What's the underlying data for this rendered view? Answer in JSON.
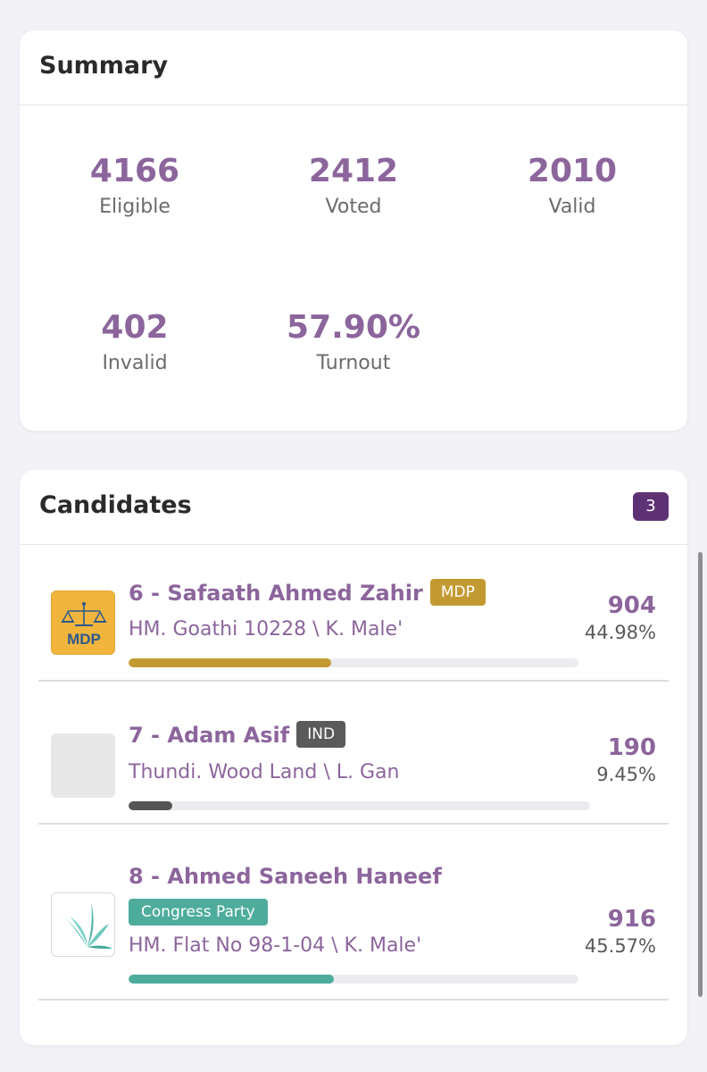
{
  "summary": {
    "title": "Summary",
    "stats": [
      {
        "value": "4166",
        "label": "Eligible"
      },
      {
        "value": "2412",
        "label": "Voted"
      },
      {
        "value": "2010",
        "label": "Valid"
      },
      {
        "value": "402",
        "label": "Invalid"
      },
      {
        "value": "57.90%",
        "label": "Turnout"
      }
    ]
  },
  "candidates": {
    "title": "Candidates",
    "count": "3",
    "items": [
      {
        "name": "6 - Safaath Ahmed Zahir",
        "party": "MDP",
        "party_color": "#c39a32",
        "logo": "MDP",
        "address": "HM. Goathi 10228 \\ K. Male'",
        "votes": "904",
        "percent": "44.98%",
        "share": 0.4498
      },
      {
        "name": "7 - Adam Asif",
        "party": "IND",
        "party_color": "#5a5a5a",
        "logo": "",
        "address": "Thundi. Wood Land \\ L. Gan",
        "votes": "190",
        "percent": "9.45%",
        "share": 0.0945
      },
      {
        "name": "8 - Ahmed Saneeh Haneef",
        "party": "Congress Party",
        "party_color": "#4eac9c",
        "logo": "",
        "address": "HM. Flat No 98-1-04 \\ K. Male'",
        "votes": "916",
        "percent": "45.57%",
        "share": 0.4557
      }
    ]
  }
}
